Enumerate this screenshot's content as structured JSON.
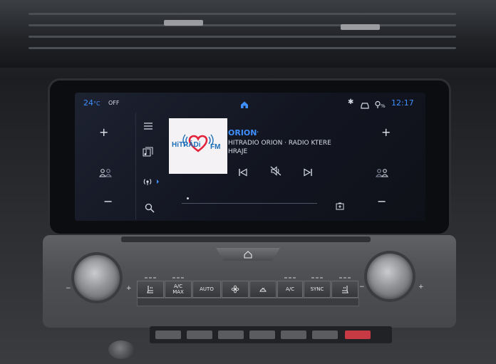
{
  "status_bar": {
    "temperature": "24",
    "temperature_unit": "°C",
    "climate_state": "OFF",
    "time": "12:17"
  },
  "radio": {
    "station_name": "ORION",
    "station_name_mark": "'",
    "station_line1": "HITRADIO ORION · RADIO KTERE",
    "station_line2": "HRAJE",
    "logo": {
      "text_hit": "HiTRÁDi",
      "text_fm": "FM"
    }
  },
  "console": {
    "buttons": [
      {
        "id": "seat-heat-left",
        "label": ""
      },
      {
        "id": "ac-max",
        "label": "A/C\nMAX"
      },
      {
        "id": "auto",
        "label": "AUTO"
      },
      {
        "id": "fan",
        "label": ""
      },
      {
        "id": "defrost",
        "label": ""
      },
      {
        "id": "ac",
        "label": "A/C"
      },
      {
        "id": "sync",
        "label": "SYNC"
      },
      {
        "id": "seat-heat-right",
        "label": ""
      }
    ]
  },
  "colors": {
    "accent": "#3f8fff",
    "logo_heart": "#e2233b",
    "logo_bg": "#f4f2f4"
  }
}
